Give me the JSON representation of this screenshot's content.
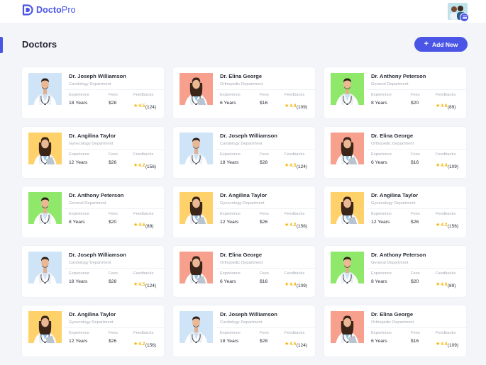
{
  "brand": {
    "name_part1": "Docto",
    "name_part2": "Pro",
    "accent": "#4a55e6"
  },
  "header": {
    "user_avatar_icon": "user-avatar",
    "menu_icon": "hamburger-menu-icon"
  },
  "page": {
    "title": "Doctors",
    "add_button_icon": "+",
    "add_button_label": "Add New"
  },
  "labels": {
    "experience": "Experience",
    "fees": "Fees",
    "feedbacks": "Feedbacks",
    "star_icon": "★"
  },
  "doctors": [
    {
      "name": "Dr. Joseph Williamson",
      "department": "Cardiology Department",
      "experience": "18 Years",
      "fees": "$28",
      "rating": "4.5",
      "reviews": "(124)",
      "photo_bg": "#cfe4f7",
      "gender": "male"
    },
    {
      "name": "Dr. Elina George",
      "department": "Orthopedic Department",
      "experience": "6 Years",
      "fees": "$16",
      "rating": "4.4",
      "reviews": "(109)",
      "photo_bg": "#f7a08e",
      "gender": "female"
    },
    {
      "name": "Dr. Anthony Peterson",
      "department": "General Department",
      "experience": "8 Years",
      "fees": "$20",
      "rating": "4.6",
      "reviews": "(89)",
      "photo_bg": "#8fe86a",
      "gender": "male"
    },
    {
      "name": "Dr. Angilina Taylor",
      "department": "Gynecology Department",
      "experience": "12 Years",
      "fees": "$26",
      "rating": "4.2",
      "reviews": "(156)",
      "photo_bg": "#ffd16b",
      "gender": "female"
    },
    {
      "name": "Dr. Joseph Williamson",
      "department": "Cardiology Department",
      "experience": "18 Years",
      "fees": "$28",
      "rating": "4.5",
      "reviews": "(124)",
      "photo_bg": "#cfe4f7",
      "gender": "male"
    },
    {
      "name": "Dr. Elina George",
      "department": "Orthopedic Department",
      "experience": "6 Years",
      "fees": "$16",
      "rating": "4.4",
      "reviews": "(109)",
      "photo_bg": "#f7a08e",
      "gender": "female"
    },
    {
      "name": "Dr. Anthony Peterson",
      "department": "General Department",
      "experience": "8 Years",
      "fees": "$20",
      "rating": "4.6",
      "reviews": "(89)",
      "photo_bg": "#8fe86a",
      "gender": "male"
    },
    {
      "name": "Dr. Angilina Taylor",
      "department": "Gynecology Department",
      "experience": "12 Years",
      "fees": "$26",
      "rating": "4.2",
      "reviews": "(156)",
      "photo_bg": "#ffd16b",
      "gender": "female"
    },
    {
      "name": "Dr. Angilina Taylor",
      "department": "Gynecology Department",
      "experience": "12 Years",
      "fees": "$26",
      "rating": "4.2",
      "reviews": "(156)",
      "photo_bg": "#ffd16b",
      "gender": "female"
    },
    {
      "name": "Dr. Joseph Williamson",
      "department": "Cardiology Department",
      "experience": "18 Years",
      "fees": "$28",
      "rating": "4.5",
      "reviews": "(124)",
      "photo_bg": "#cfe4f7",
      "gender": "male"
    },
    {
      "name": "Dr. Elina George",
      "department": "Orthopedic Department",
      "experience": "6 Years",
      "fees": "$16",
      "rating": "4.4",
      "reviews": "(109)",
      "photo_bg": "#f7a08e",
      "gender": "female"
    },
    {
      "name": "Dr. Anthony Peterson",
      "department": "General Department",
      "experience": "8 Years",
      "fees": "$20",
      "rating": "4.6",
      "reviews": "(89)",
      "photo_bg": "#8fe86a",
      "gender": "male"
    },
    {
      "name": "Dr. Angilina Taylor",
      "department": "Gynecology Department",
      "experience": "12 Years",
      "fees": "$26",
      "rating": "4.2",
      "reviews": "(156)",
      "photo_bg": "#ffd16b",
      "gender": "female"
    },
    {
      "name": "Dr. Joseph Williamson",
      "department": "Cardiology Department",
      "experience": "18 Years",
      "fees": "$28",
      "rating": "4.5",
      "reviews": "(124)",
      "photo_bg": "#cfe4f7",
      "gender": "male"
    },
    {
      "name": "Dr. Elina George",
      "department": "Orthopedic Department",
      "experience": "6 Years",
      "fees": "$16",
      "rating": "4.4",
      "reviews": "(109)",
      "photo_bg": "#f7a08e",
      "gender": "female"
    }
  ]
}
